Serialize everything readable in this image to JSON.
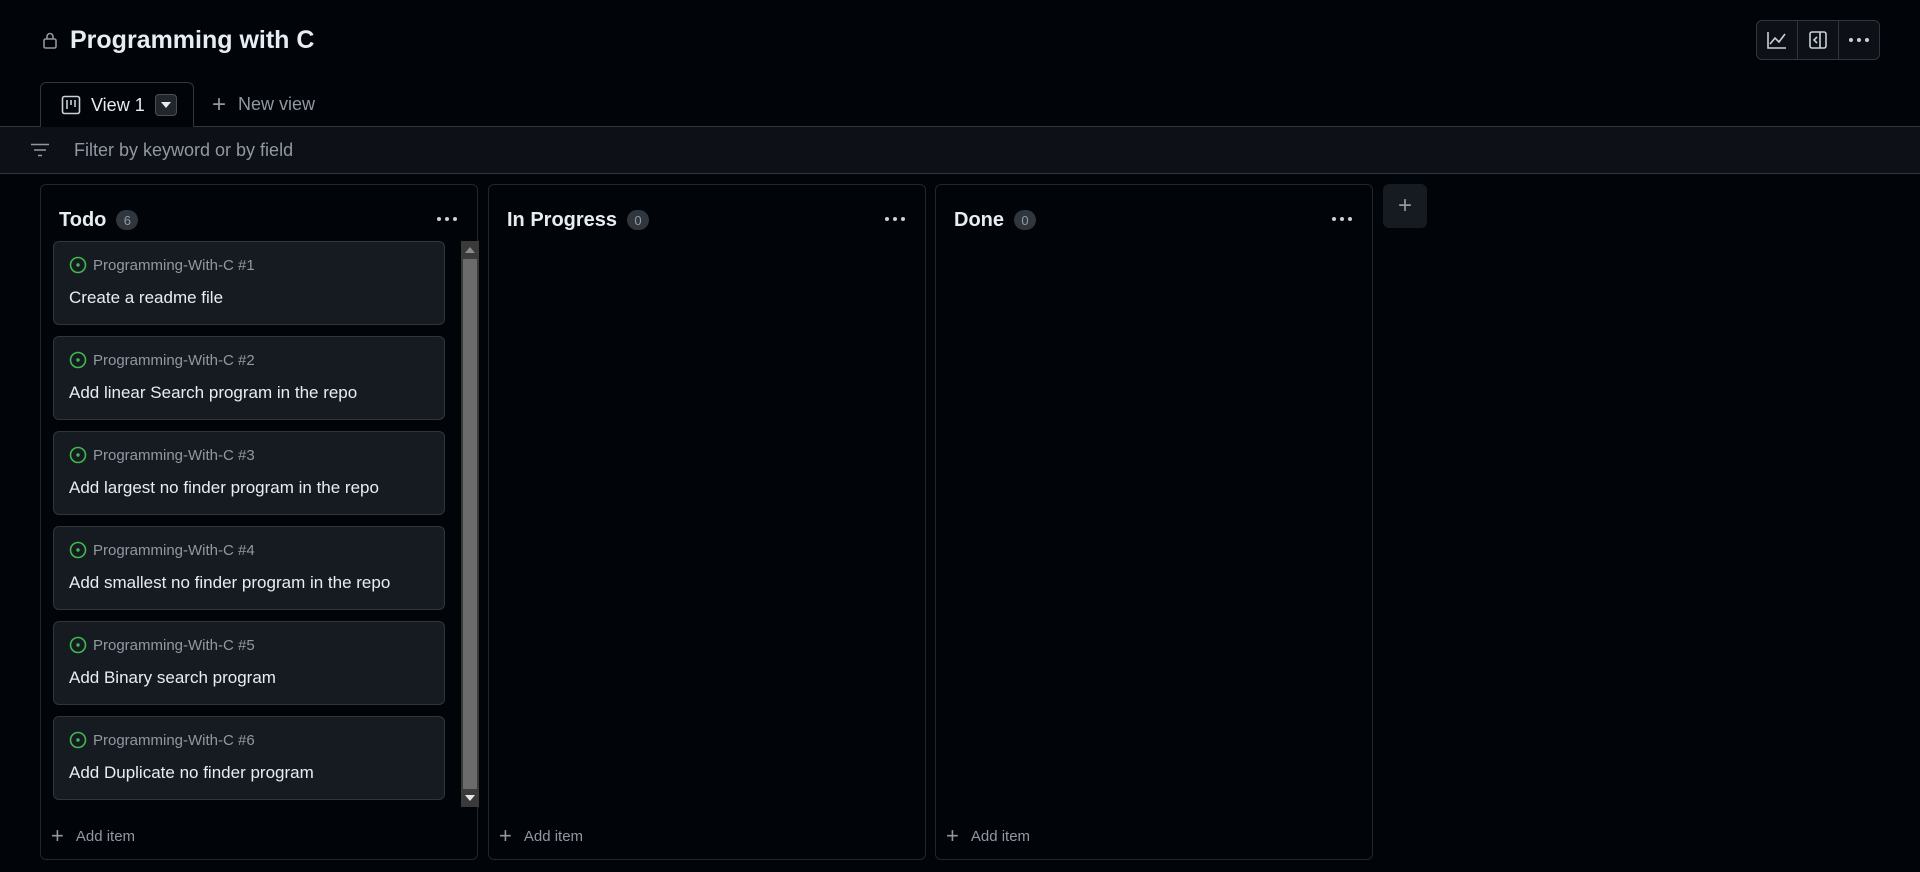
{
  "project": {
    "title": "Programming with C"
  },
  "toolbar": {
    "insights_icon": "graph-icon",
    "sidepanel_icon": "sidebar-expand-icon",
    "more_icon": "kebab-horizontal-icon"
  },
  "tabs": [
    {
      "label": "View 1",
      "icon": "project-board-icon",
      "active": true
    }
  ],
  "new_view": {
    "label": "New view"
  },
  "filter": {
    "placeholder": "Filter by keyword or by field",
    "value": ""
  },
  "columns": [
    {
      "name": "Todo",
      "count": "6",
      "add_item_label": "Add item",
      "cards": [
        {
          "repo": "Programming-With-C #1",
          "title": "Create a readme file"
        },
        {
          "repo": "Programming-With-C #2",
          "title": "Add linear Search program in the repo"
        },
        {
          "repo": "Programming-With-C #3",
          "title": "Add largest no finder program in the repo"
        },
        {
          "repo": "Programming-With-C #4",
          "title": "Add smallest no finder program in the repo"
        },
        {
          "repo": "Programming-With-C #5",
          "title": "Add Binary search program"
        },
        {
          "repo": "Programming-With-C #6",
          "title": "Add Duplicate no finder program"
        }
      ]
    },
    {
      "name": "In Progress",
      "count": "0",
      "add_item_label": "Add item",
      "cards": []
    },
    {
      "name": "Done",
      "count": "0",
      "add_item_label": "Add item",
      "cards": []
    }
  ],
  "add_column": {
    "label": "+"
  },
  "colors": {
    "background": "#010409",
    "card": "#161b22",
    "border": "#30363d",
    "open_issue": "#3fb950",
    "muted": "#9198a1"
  }
}
